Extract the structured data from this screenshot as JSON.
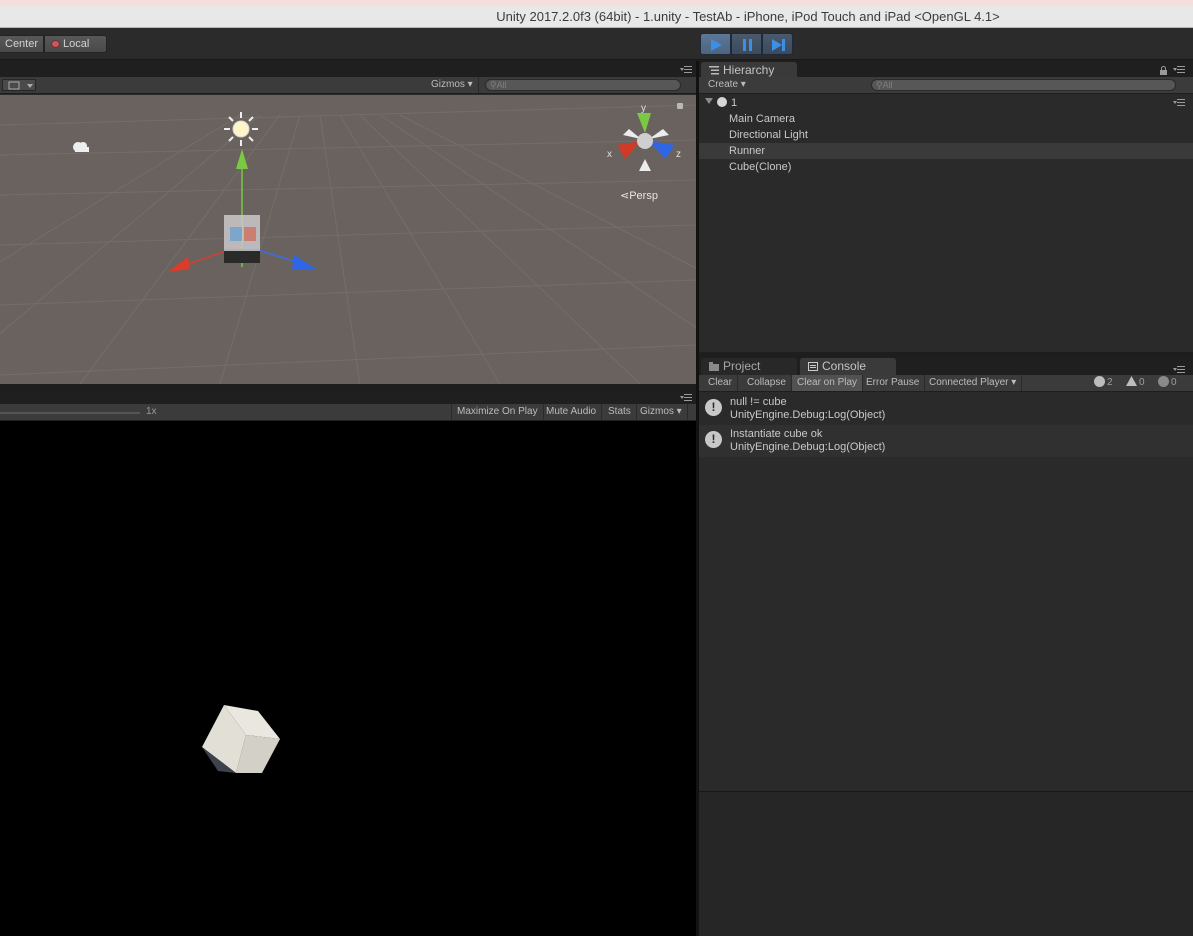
{
  "window": {
    "title": "Unity 2017.2.0f3 (64bit) - 1.unity - TestAb - iPhone, iPod Touch and iPad <OpenGL 4.1>"
  },
  "toolbar": {
    "pivot_label": "Center",
    "space_label": "Local",
    "play_icon": "play-icon",
    "pause_icon": "pause-icon",
    "step_icon": "step-icon",
    "accent_color": "#3d8fe6"
  },
  "scene": {
    "gizmos_label": "Gizmos",
    "search_placeholder": "All",
    "axis_x": "x",
    "axis_y": "y",
    "axis_z": "z",
    "projection_label": "Persp"
  },
  "game": {
    "scale_label": "1x",
    "maximize_label": "Maximize On Play",
    "mute_label": "Mute Audio",
    "stats_label": "Stats",
    "gizmos_label": "Gizmos"
  },
  "hierarchy": {
    "tab_label": "Hierarchy",
    "create_label": "Create",
    "search_placeholder": "All",
    "scene_name": "1",
    "items": [
      {
        "label": "Main Camera"
      },
      {
        "label": "Directional Light"
      },
      {
        "label": "Runner"
      },
      {
        "label": "Cube(Clone)"
      }
    ]
  },
  "console": {
    "tab_project": "Project",
    "tab_console": "Console",
    "clear_label": "Clear",
    "collapse_label": "Collapse",
    "clear_on_play_label": "Clear on Play",
    "error_pause_label": "Error Pause",
    "connected_player_label": "Connected Player",
    "info_count": "2",
    "warn_count": "0",
    "error_count": "0",
    "logs": [
      {
        "message": "null != cube",
        "trace": "UnityEngine.Debug:Log(Object)"
      },
      {
        "message": "Instantiate cube ok",
        "trace": "UnityEngine.Debug:Log(Object)"
      }
    ]
  }
}
